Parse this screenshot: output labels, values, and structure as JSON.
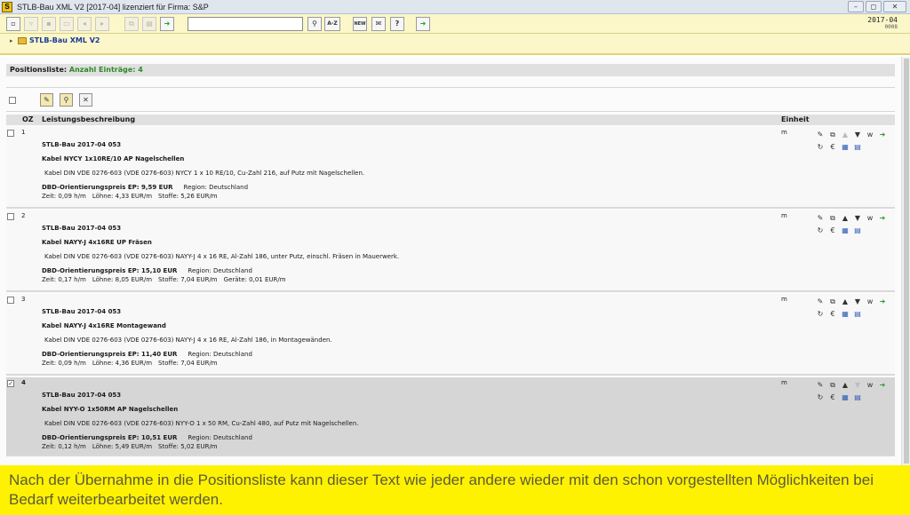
{
  "window": {
    "icon_letter": "S",
    "title": "STLB-Bau XML V2 [2017-04] lizenziert für Firma: S&P",
    "controls": [
      "–",
      "◻",
      "✕"
    ]
  },
  "toolbar": {
    "search_value": "",
    "sort_label": "A-Z",
    "new_label": "NEW",
    "help_label": "?",
    "version": "2017-04",
    "version_sub": "0008"
  },
  "tree": {
    "arrow": "▸",
    "root_label": "STLB-Bau XML V2"
  },
  "positionsliste": {
    "label": "Positionsliste:",
    "count_label": "Anzahl Einträge: 4"
  },
  "columns": {
    "oz": "OZ",
    "beschreibung": "Leistungsbeschreibung",
    "einheit": "Einheit"
  },
  "positions": [
    {
      "oz": "1",
      "checked": false,
      "unit": "m",
      "catalog": "STLB-Bau 2017-04 053",
      "title": "Kabel NYCY 1x10RE/10 AP Nagelschellen",
      "description": "Kabel DIN VDE 0276-603 (VDE 0276-603) NYCY 1 x 10 RE/10, Cu-Zahl 216, auf Putz mit Nagelschellen.",
      "price": "DBD-Orientierungspreis EP: 9,59 EUR",
      "region": "Region: Deutschland",
      "zeit": "Zeit: 0,09 h/m",
      "loehne": "Löhne: 4,33 EUR/m",
      "stoffe": "Stoffe: 5,26 EUR/m",
      "geraete": ""
    },
    {
      "oz": "2",
      "checked": false,
      "unit": "m",
      "catalog": "STLB-Bau 2017-04 053",
      "title": "Kabel NAYY-J 4x16RE UP Fräsen",
      "description": "Kabel DIN VDE 0276-603 (VDE 0276-603) NAYY-J 4 x 16 RE, Al-Zahl 186, unter Putz, einschl. Fräsen in Mauerwerk.",
      "price": "DBD-Orientierungspreis EP: 15,10 EUR",
      "region": "Region: Deutschland",
      "zeit": "Zeit: 0,17 h/m",
      "loehne": "Löhne: 8,05 EUR/m",
      "stoffe": "Stoffe: 7,04 EUR/m",
      "geraete": "Geräte: 0,01 EUR/m"
    },
    {
      "oz": "3",
      "checked": false,
      "unit": "m",
      "catalog": "STLB-Bau 2017-04 053",
      "title": "Kabel NAYY-J 4x16RE Montagewand",
      "description": "Kabel DIN VDE 0276-603 (VDE 0276-603) NAYY-J 4 x 16 RE, Al-Zahl 186, in Montagewänden.",
      "price": "DBD-Orientierungspreis EP: 11,40 EUR",
      "region": "Region: Deutschland",
      "zeit": "Zeit: 0,09 h/m",
      "loehne": "Löhne: 4,36 EUR/m",
      "stoffe": "Stoffe: 7,04 EUR/m",
      "geraete": ""
    },
    {
      "oz": "4",
      "checked": true,
      "unit": "m",
      "catalog": "STLB-Bau 2017-04 053",
      "title": "Kabel NYY-O 1x50RM AP Nagelschellen",
      "description": "Kabel DIN VDE 0276-603 (VDE 0276-603) NYY-O 1 x 50 RM, Cu-Zahl 480, auf Putz mit Nagelschellen.",
      "price": "DBD-Orientierungspreis EP: 10,51 EUR",
      "region": "Region: Deutschland",
      "zeit": "Zeit: 0,12 h/m",
      "loehne": "Löhne: 5,49 EUR/m",
      "stoffe": "Stoffe: 5,02 EUR/m",
      "geraete": ""
    }
  ],
  "row_actions": {
    "edit": "✎",
    "copy": "⧉",
    "up": "▲",
    "down": "▼",
    "w": "w",
    "export": "➜",
    "refresh": "↻",
    "euro": "€",
    "table": "▦",
    "doc": "▤"
  },
  "caption": "Nach der Übernahme in die Positionsliste kann dieser Text wie jeder andere wieder mit den schon vorgestellten Möglichkeiten bei Bedarf weiterbearbeitet werden."
}
